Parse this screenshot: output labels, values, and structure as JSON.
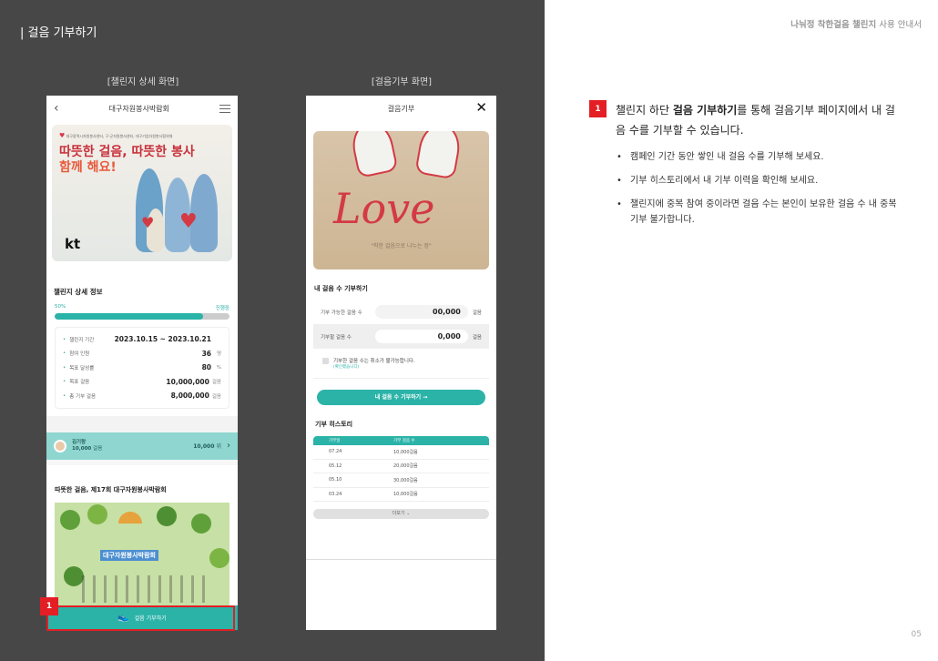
{
  "page": {
    "title": "| 걸음 기부하기",
    "brand_bold": "나눠정 착한걸음 챌린지",
    "brand_rest": " 사용 안내서",
    "page_number": "05"
  },
  "captions": {
    "left": "[챌린지 상세 화면]",
    "right": "[걸음기부 화면]"
  },
  "challenge_screen": {
    "header_title": "대구자원봉사박람회",
    "banner": {
      "org": "대구광역시자원봉사센터, 구·군자원봉사센터, 대구기업자원봉사협의체",
      "line1": "따뜻한 걸음, 따뜻한 봉사",
      "line2": "함께 해요!",
      "sponsor": "kt"
    },
    "detail_title": "챌린지 상세 정보",
    "progress": {
      "percent_label": "50%",
      "status": "진행중",
      "fill_fraction": 0.85
    },
    "info": [
      {
        "label": "챌린지 기간",
        "value": "2023.10.15 ~ 2023.10.21",
        "unit": ""
      },
      {
        "label": "참여 인원",
        "value": "36",
        "unit": "명"
      },
      {
        "label": "목표 달성률",
        "value": "80",
        "unit": "%"
      },
      {
        "label": "목표 걸음",
        "value": "10,000,000",
        "unit": "걸음"
      },
      {
        "label": "총 기부 걸음",
        "value": "8,000,000",
        "unit": "걸음"
      }
    ],
    "user": {
      "name": "김기랑",
      "steps": "10,000",
      "steps_unit": "걸음",
      "rank_value": "10,000",
      "rank_unit": "위"
    },
    "event_title": "따뜻한 걸음, 제17회 대구자원봉사박람회",
    "poster_title": "대구자원봉사박람회",
    "step_button": "걸음 기부하기"
  },
  "donate_screen": {
    "header_title": "걸음기부",
    "close_icon": "✕",
    "image_caption": "\"착한 걸음으로 나누는 정\"",
    "section_title": "내 걸음 수 기부하기",
    "available": {
      "label": "기부 가능한 걸음 수",
      "value": "00,000",
      "unit": "걸음"
    },
    "donate_input": {
      "label": "기부할 걸음 수",
      "value": "0,000",
      "unit": "걸음"
    },
    "notice": {
      "text": "기부한 걸음 수는 취소가 불가능합니다.",
      "sub": "(확인했습니다)"
    },
    "donate_button": "내 걸음 수 기부하기 →",
    "history_title": "기부 히스토리",
    "history_headers": {
      "date": "기부일",
      "steps": "기부 걸음 수"
    },
    "history": [
      {
        "date": "07.24",
        "steps": "10,000걸음"
      },
      {
        "date": "05.12",
        "steps": "20,000걸음"
      },
      {
        "date": "05.10",
        "steps": "30,000걸음"
      },
      {
        "date": "03.24",
        "steps": "10,000걸음"
      }
    ],
    "more_button": "더보기 ⌄"
  },
  "markers": {
    "badge": "1"
  },
  "guide": {
    "main_pre": "챌린지 하단 ",
    "main_bold": "걸음 기부하기",
    "main_post": "를 통해 걸음기부 페이지에서 내 걸음 수를 기부할 수 있습니다.",
    "bullets": [
      "캠페인 기간 동안 쌓인 내 걸음 수를 기부해 보세요.",
      "기부 히스토리에서 내 기부 이력을 확인해 보세요.",
      "챌린지에 중복 참여 중이라면 걸음 수는 본인이 보유한 걸음 수 내 중복 기부 불가합니다."
    ]
  },
  "colors": {
    "accent": "#2bb3a8",
    "marker": "#e31e24",
    "left_bg": "#474747"
  }
}
